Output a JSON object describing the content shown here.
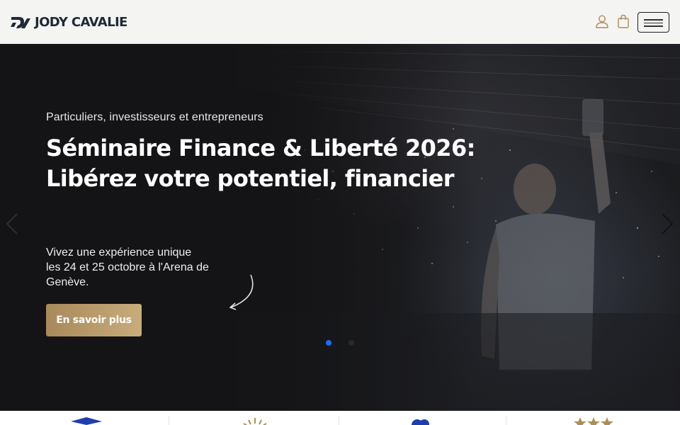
{
  "header": {
    "logo_text": "JODY CAVALIE",
    "icons": {
      "user": "user-icon",
      "cart": "cart-icon",
      "menu": "hamburger-menu-icon"
    },
    "colors": {
      "background": "#f4f4f2",
      "logo": "#1f2a37",
      "icon_gold": "#b08d57"
    }
  },
  "hero": {
    "eyebrow": "Particuliers, investisseurs et entrepreneurs",
    "title": "Séminaire Finance & Liberté 2026: Libérez votre potentiel, financier",
    "description": "Vivez une expérience unique les 24 et 25 octobre à l'Arena de Genève.",
    "cta_label": "En savoir plus",
    "carousel": {
      "slide_count": 2,
      "active_slide": 1
    },
    "colors": {
      "cta_gold": "#b89a6a",
      "active_dot": "#1a6cff"
    }
  },
  "features_strip": {
    "icons": [
      "graduation-cap-icon",
      "sunburst-icon",
      "blue-shape-icon",
      "stars-icon"
    ]
  }
}
